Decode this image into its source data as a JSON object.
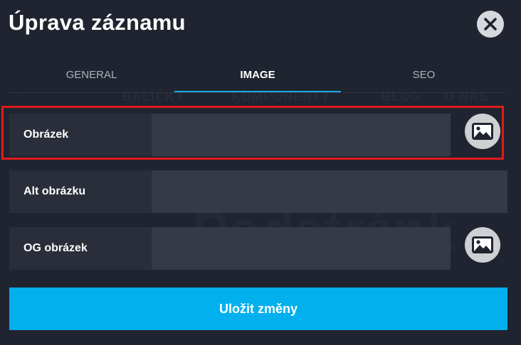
{
  "modal": {
    "title": "Úprava záznamu",
    "close_icon": "close-icon"
  },
  "background_ghost": {
    "nav_items": [
      "BALÍČKY",
      "KOMPONENTY",
      "BLOG",
      "O NÁS"
    ],
    "heading": "Podstránk"
  },
  "tabs": [
    {
      "label": "GENERAL",
      "active": false
    },
    {
      "label": "IMAGE",
      "active": true
    },
    {
      "label": "SEO",
      "active": false
    }
  ],
  "fields": {
    "image": {
      "label": "Obrázek",
      "value": "",
      "icon": "image-icon",
      "highlighted": true
    },
    "alt": {
      "label": "Alt obrázku",
      "value": ""
    },
    "og_image": {
      "label": "OG obrázek",
      "value": "",
      "icon": "image-icon"
    }
  },
  "save_button": {
    "label": "Uložit změny"
  },
  "colors": {
    "background": "#1f2430",
    "label_bg": "#292e3a",
    "input_bg": "#353a47",
    "accent": "#02b0ee",
    "tab_indicator": "#1da9e4",
    "highlight": "#e01b1b"
  }
}
